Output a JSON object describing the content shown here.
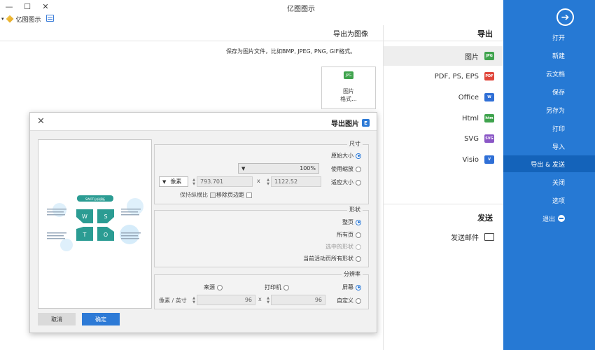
{
  "window": {
    "title": "亿图图示",
    "minimize": "—",
    "maximize": "☐",
    "close": "✕",
    "app_tab": "亿图图示",
    "app_tab_caret": "▾"
  },
  "sidebar": {
    "back_icon": "arrow-right-circle-icon",
    "items": [
      {
        "label": "打开"
      },
      {
        "label": "新建"
      },
      {
        "label": "云文档"
      },
      {
        "label": "保存"
      },
      {
        "label": "另存为"
      },
      {
        "label": "打印"
      },
      {
        "label": "导入"
      },
      {
        "label": "导出 & 发送"
      },
      {
        "label": "关闭"
      },
      {
        "label": "选项"
      },
      {
        "label": "退出"
      }
    ],
    "active_index": 7
  },
  "export": {
    "heading": "导出",
    "formats": [
      {
        "label": "图片",
        "icon_text": "JPG",
        "color": "#3fa34d"
      },
      {
        "label": "PDF, PS, EPS",
        "icon_text": "PDF",
        "color": "#e0453a"
      },
      {
        "label": "Office",
        "icon_text": "W",
        "color": "#2f6fd6"
      },
      {
        "label": "Html",
        "icon_text": "htm",
        "color": "#3fa34d"
      },
      {
        "label": "SVG",
        "icon_text": "SVG",
        "color": "#8a56c6"
      },
      {
        "label": "Visio",
        "icon_text": "V",
        "color": "#2f6fd6"
      }
    ],
    "send_heading": "发送",
    "send_items": [
      {
        "label": "发送邮件"
      }
    ]
  },
  "detail": {
    "title": "导出为图像",
    "description": "保存为图片文件，比如BMP, JPEG, PNG, GIF格式。",
    "card_icon_text": "JPG",
    "card_line1": "图片",
    "card_line2": "格式..."
  },
  "dialog": {
    "title": "导出图片",
    "close": "✕",
    "size": {
      "label": "尺寸",
      "original": "原始大小",
      "use_zoom": "使用缩放",
      "zoom_value": "100%",
      "fit": "适应大小",
      "width": "1122.52",
      "times": "x",
      "height": "793.701",
      "unit": "像素",
      "remove_margin": "移除页边距",
      "keep_ratio": "保持纵横比"
    },
    "shape": {
      "label": "形状",
      "current_page": "整页",
      "all_pages": "所有页",
      "selected": "选中的形状",
      "current_all": "当前活动页所有形状"
    },
    "resolution": {
      "label": "分辨率",
      "screen": "屏幕",
      "printer": "打印机",
      "source": "来源",
      "custom": "自定义",
      "dpi_x": "96",
      "times": "x",
      "dpi_y": "96",
      "unit": "像素 / 英寸"
    },
    "ok": "确定",
    "cancel": "取消"
  },
  "preview_diagram": {
    "title": "SWOT分析模板",
    "letters": [
      "W",
      "S",
      "T",
      "O"
    ],
    "color": "#2b9c93"
  }
}
